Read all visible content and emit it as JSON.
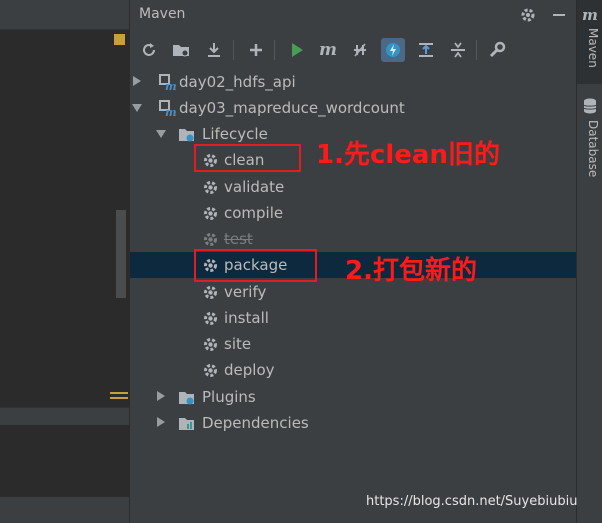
{
  "panel": {
    "title": "Maven"
  },
  "header_icons": [
    "gear-icon",
    "minimize-icon"
  ],
  "toolbar": [
    {
      "name": "reload-icon"
    },
    {
      "name": "add-folder-icon"
    },
    {
      "name": "download-icon"
    },
    {
      "name": "add-icon"
    },
    {
      "name": "run-icon"
    },
    {
      "name": "maven-goal-icon"
    },
    {
      "name": "toggle-offline-icon"
    },
    {
      "name": "skip-tests-icon"
    },
    {
      "name": "show-dependencies-icon"
    },
    {
      "name": "collapse-icon"
    },
    {
      "name": "settings-wrench-icon"
    }
  ],
  "tree": {
    "project1": "day02_hdfs_api",
    "project2": "day03_mapreduce_wordcount",
    "lifecycle": "Lifecycle",
    "goals": [
      "clean",
      "validate",
      "compile",
      "test",
      "package",
      "verify",
      "install",
      "site",
      "deploy"
    ],
    "plugins": "Plugins",
    "dependencies": "Dependencies"
  },
  "annotations": {
    "step1": "1.先clean旧的",
    "step2": "2.打包新的"
  },
  "side_tabs": {
    "maven": "Maven",
    "database": "Database"
  },
  "watermark": "https://blog.csdn.net/Suyebiubiu",
  "colors": {
    "accent_red": "#ff1a1a",
    "selection": "#0d293e",
    "run_green": "#499c54"
  }
}
